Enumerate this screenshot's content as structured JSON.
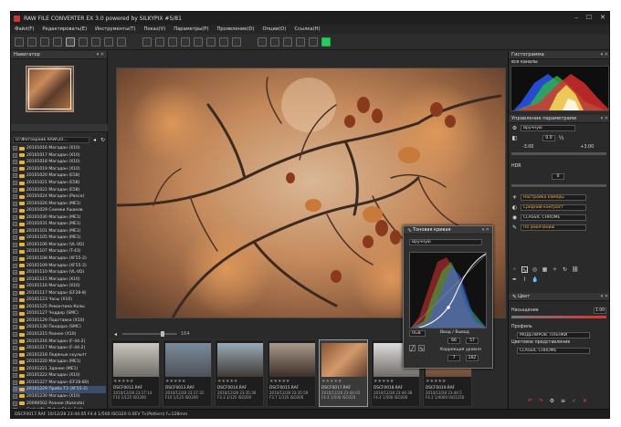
{
  "app": {
    "title": "RAW FILE CONVERTER EX 3.0 powered by SILKYPIX  #5/81"
  },
  "menu": [
    "Файл(F)",
    "Редактировать(E)",
    "Инструменты(T)",
    "Показ(V)",
    "Параметры(P)",
    "Проявление(D)",
    "Опции(O)",
    "Ссылка(H)"
  ],
  "navigator": {
    "title": "Навигатор"
  },
  "folders": {
    "path": "D:\\Фотоархив RAW\\20...",
    "items": [
      "20101016 Магадан (X10)",
      "20101017 Магадан (X10)",
      "20101018 Магадан (X10)",
      "20101019 Магадан (X10)",
      "20101020 Магадан (E58)",
      "20101021 Магадан (E58)",
      "20101022 Магадан (E58)",
      "20101024 Магадан (Panco)",
      "20101026 Магадан (ME1)",
      "20101029 Снимки Ушаков",
      "20101030 Магадан (ME1)",
      "20101031 Магадан (ME1)",
      "20101101 Магадан (ME1)",
      "20101105 Магадан (ME1)",
      "20101106 Магадан (VL-VD)",
      "20101107 Магадан (T-43)",
      "20101108 Магадан (XF55-2)",
      "20101109 Магадан (XF55-2)",
      "20101110 Магадан (VL-VD)",
      "20101115 Магадан (X10)",
      "20101116 Магадан (X10)",
      "20101117 Магадан (EF28-8)",
      "20101123 Часы (X10)",
      "20101125 Романтика Колы",
      "20101127 Чеддер (SMC)",
      "20101129 Подставка (X10)",
      "20101130 Пандора (SMC)",
      "20101215 Разное (X10)",
      "20101216 Магадан (F-44-2)",
      "20101217 Магадан (F-44-2)",
      "20101218 Ледяные скульпт",
      "20101220 Магадан (ME1)",
      "20101221 Здание (ME1)",
      "20101222 Магадан (X10)",
      "20101227 Магадан (EF28-80)",
      "20101229 Проба Т3 (XF55-2)",
      "20101230 Магадан (X10)",
      "20090502 Разное (Kasinda)",
      "CaduelNu PictureStyle Colle",
      "Пересвет",
      "Проба эспонирования"
    ],
    "selected_index": 35
  },
  "filmstrip": {
    "zoom": "164",
    "thumbs": [
      {
        "name": "DSCF0012.RAF",
        "date": "2010/12/28 23:17:14",
        "exif": "F10 1/125 ISO200",
        "rating": "★★★★★"
      },
      {
        "name": "DSCF0013.RAF",
        "date": "2010/12/28 23:17:31",
        "exif": "F10 1/125 ISO200",
        "rating": "★★★★★"
      },
      {
        "name": "DSCF0014.RAF",
        "date": "2010/12/28 23:35:36",
        "exif": "F3.3 1/125 ISO200",
        "rating": "★★★★★"
      },
      {
        "name": "DSCF0015.RAF",
        "date": "2010/12/28 23:35:59",
        "exif": "F3.7 1/125 ISO200",
        "rating": "★★★★★"
      },
      {
        "name": "DSCF0017.RAF",
        "date": "2010/12/28 23:44:05",
        "exif": "F4.4 1/500 ISO320",
        "rating": "★★★★★"
      },
      {
        "name": "DSCF0018.RAF",
        "date": "2010/12/28 23:44:38",
        "exif": "F4.4 1/500 ISO200",
        "rating": "★★★★★"
      },
      {
        "name": "DSCF0019.RAF",
        "date": "2010/12/28 23:44:5",
        "exif": "F4.2 1/4000 ISO1250",
        "rating": "★★★★★"
      }
    ],
    "selected_index": 4
  },
  "status": "DSCF0017.RAF 10/12/28 23:44:05 F4.4 1/500 ISO320  0.0EV Tv(Pattern) f=128mm",
  "histogram": {
    "title": "Гистограмма",
    "channel": "все каналы"
  },
  "params": {
    "title": "Управление параметрами",
    "wb_mode": "Вручную",
    "wb_value": "0.0",
    "exposure_min": "-3.00",
    "exposure_max": "+3.00",
    "hdr_label": "HDR",
    "hdr_value": "0",
    "camera_setting": "Настройка камеры",
    "contrast": "Средний контраст",
    "color": "CLASSIC CHROME",
    "sharpness": "По умолчанию"
  },
  "color_panel": {
    "title": "Цвет",
    "saturation_label": "Насыщение",
    "saturation_value": "1.00",
    "profile_label": "Профиль",
    "profile_value": "МОДЕЛИРОВ. ПЛЕНКИ",
    "cs_label": "Цветовое представление",
    "cs_value": "CLASSIC CHROME"
  },
  "tone_curve": {
    "title": "Тоновая кривая",
    "mode": "Вручную",
    "channel": "RGB",
    "io_label": "Ввод / Вывод",
    "in": "66",
    "out": "57",
    "level_label": "Коррекция уровня",
    "level_low": "7",
    "level_high": "202"
  },
  "colors": {
    "accent": "#3b4e6b",
    "folder": "#e3b341"
  }
}
